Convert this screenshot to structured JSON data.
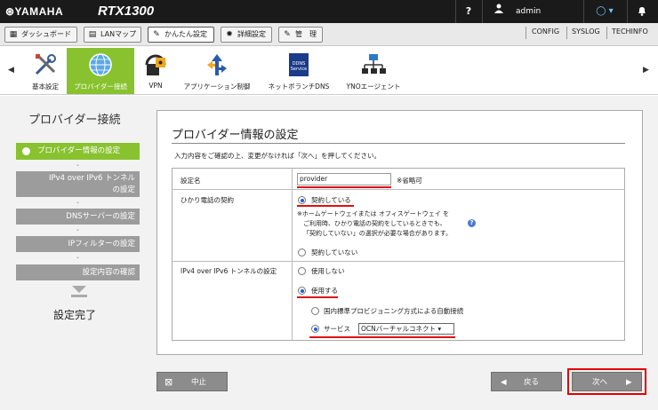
{
  "header": {
    "logo": "⊛YAMAHA",
    "model": "RTX1300",
    "help": "?",
    "user": "admin",
    "status": "◯ ▾",
    "bell_icon": "bell-icon"
  },
  "tabs": [
    {
      "label": "ダッシュボード",
      "icon": "▦"
    },
    {
      "label": "LANマップ",
      "icon": "▤"
    },
    {
      "label": "かんたん設定",
      "icon": "✎"
    },
    {
      "label": "詳細設定",
      "icon": "✹"
    },
    {
      "label": "管　理",
      "icon": "✎"
    }
  ],
  "right_links": [
    "CONFIG",
    "SYSLOG",
    "TECHINFO"
  ],
  "wizard_items": [
    {
      "label": "基本設定",
      "icon": "tools-icon"
    },
    {
      "label": "プロバイダー接続",
      "icon": "globe-icon"
    },
    {
      "label": "VPN",
      "icon": "lock-icon"
    },
    {
      "label": "アプリケーション制御",
      "icon": "arrows-icon"
    },
    {
      "label": "ネットボランチDNS",
      "icon": "ddns-icon"
    },
    {
      "label": "YNOエージェント",
      "icon": "network-icon"
    }
  ],
  "ddns_text": "DDNS Service",
  "nav": {
    "left": "◀",
    "right": "▶"
  },
  "sidebar": {
    "title": "プロバイダー接続",
    "steps": [
      "プロバイダー情報の設定",
      "IPv4 over IPv6 トンネル",
      "の設定",
      "DNSサーバーの設定",
      "IPフィルターの設定",
      "設定内容の確認"
    ],
    "done": "設定完了",
    "chevron": "⌄"
  },
  "panel": {
    "title": "プロバイダー情報の設定",
    "desc": "入力内容をご確認の上、変更がなければ「次へ」を押してください。"
  },
  "form": {
    "name_label": "設定名",
    "name_value": "provider",
    "name_note": "※省略可",
    "hikari_label": "ひかり電話の契約",
    "hikari_yes": "契約している",
    "hikari_note": [
      "※ホームゲートウェイまたは オフィスゲートウェイ を",
      "ご利用時、ひかり電話の契約をしているときでも、",
      "「契約していない」の選択が必要な場合があります。"
    ],
    "hikari_help": "?",
    "hikari_no": "契約していない",
    "tunnel_label": "IPv4 over IPv6 トンネルの設定",
    "tunnel_no": "使用しない",
    "tunnel_yes": "使用する",
    "auto": "国内標準プロビジョニング方式による自動接続",
    "service": "サービス",
    "service_value": "OCNバーチャルコネクト ▾"
  },
  "buttons": {
    "cancel": "中止",
    "back": "戻る",
    "next": "次へ",
    "cancel_icon": "⊠",
    "back_icon": "◀",
    "next_icon": "▶"
  }
}
